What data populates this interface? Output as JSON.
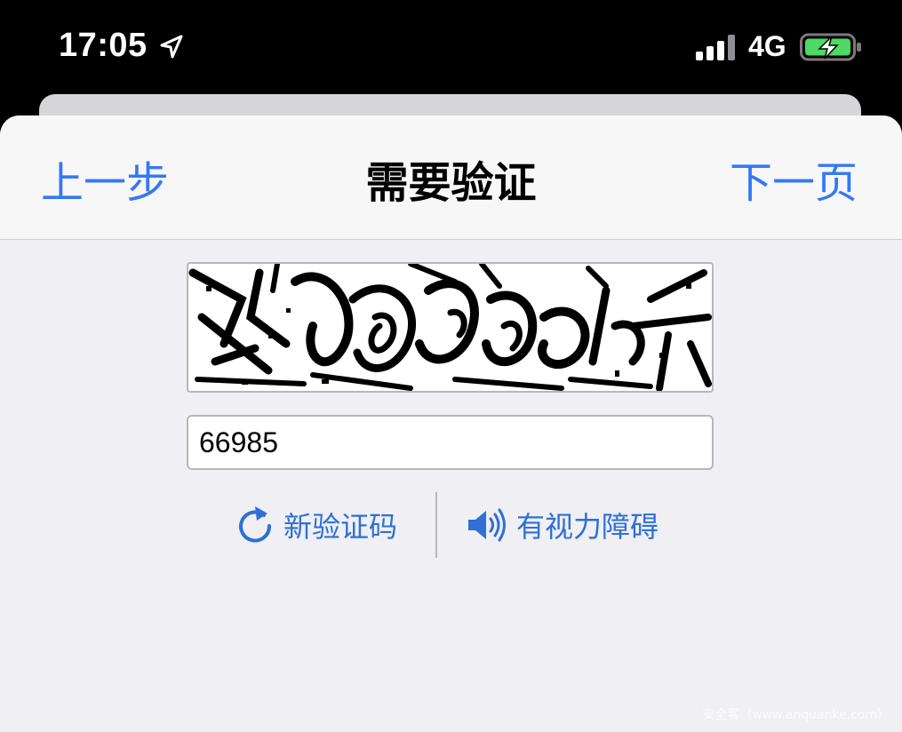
{
  "status_bar": {
    "time": "17:05",
    "network": "4G",
    "icons": [
      "location-arrow-icon",
      "cellular-signal-icon",
      "battery-charging-icon"
    ],
    "battery_color": "#4cd964"
  },
  "nav": {
    "back_label": "上一步",
    "title": "需要验证",
    "next_label": "下一页"
  },
  "captcha": {
    "input_value": "66985"
  },
  "actions": {
    "new_code_label": "新验证码",
    "new_code_icon": "refresh-icon",
    "audio_label": "有视力障碍",
    "audio_icon": "speaker-icon"
  },
  "watermark": "安全客（www.anquanke.com）",
  "colors": {
    "accent": "#3478f6",
    "background": "#efeff4",
    "navbar": "#f7f7f8"
  }
}
